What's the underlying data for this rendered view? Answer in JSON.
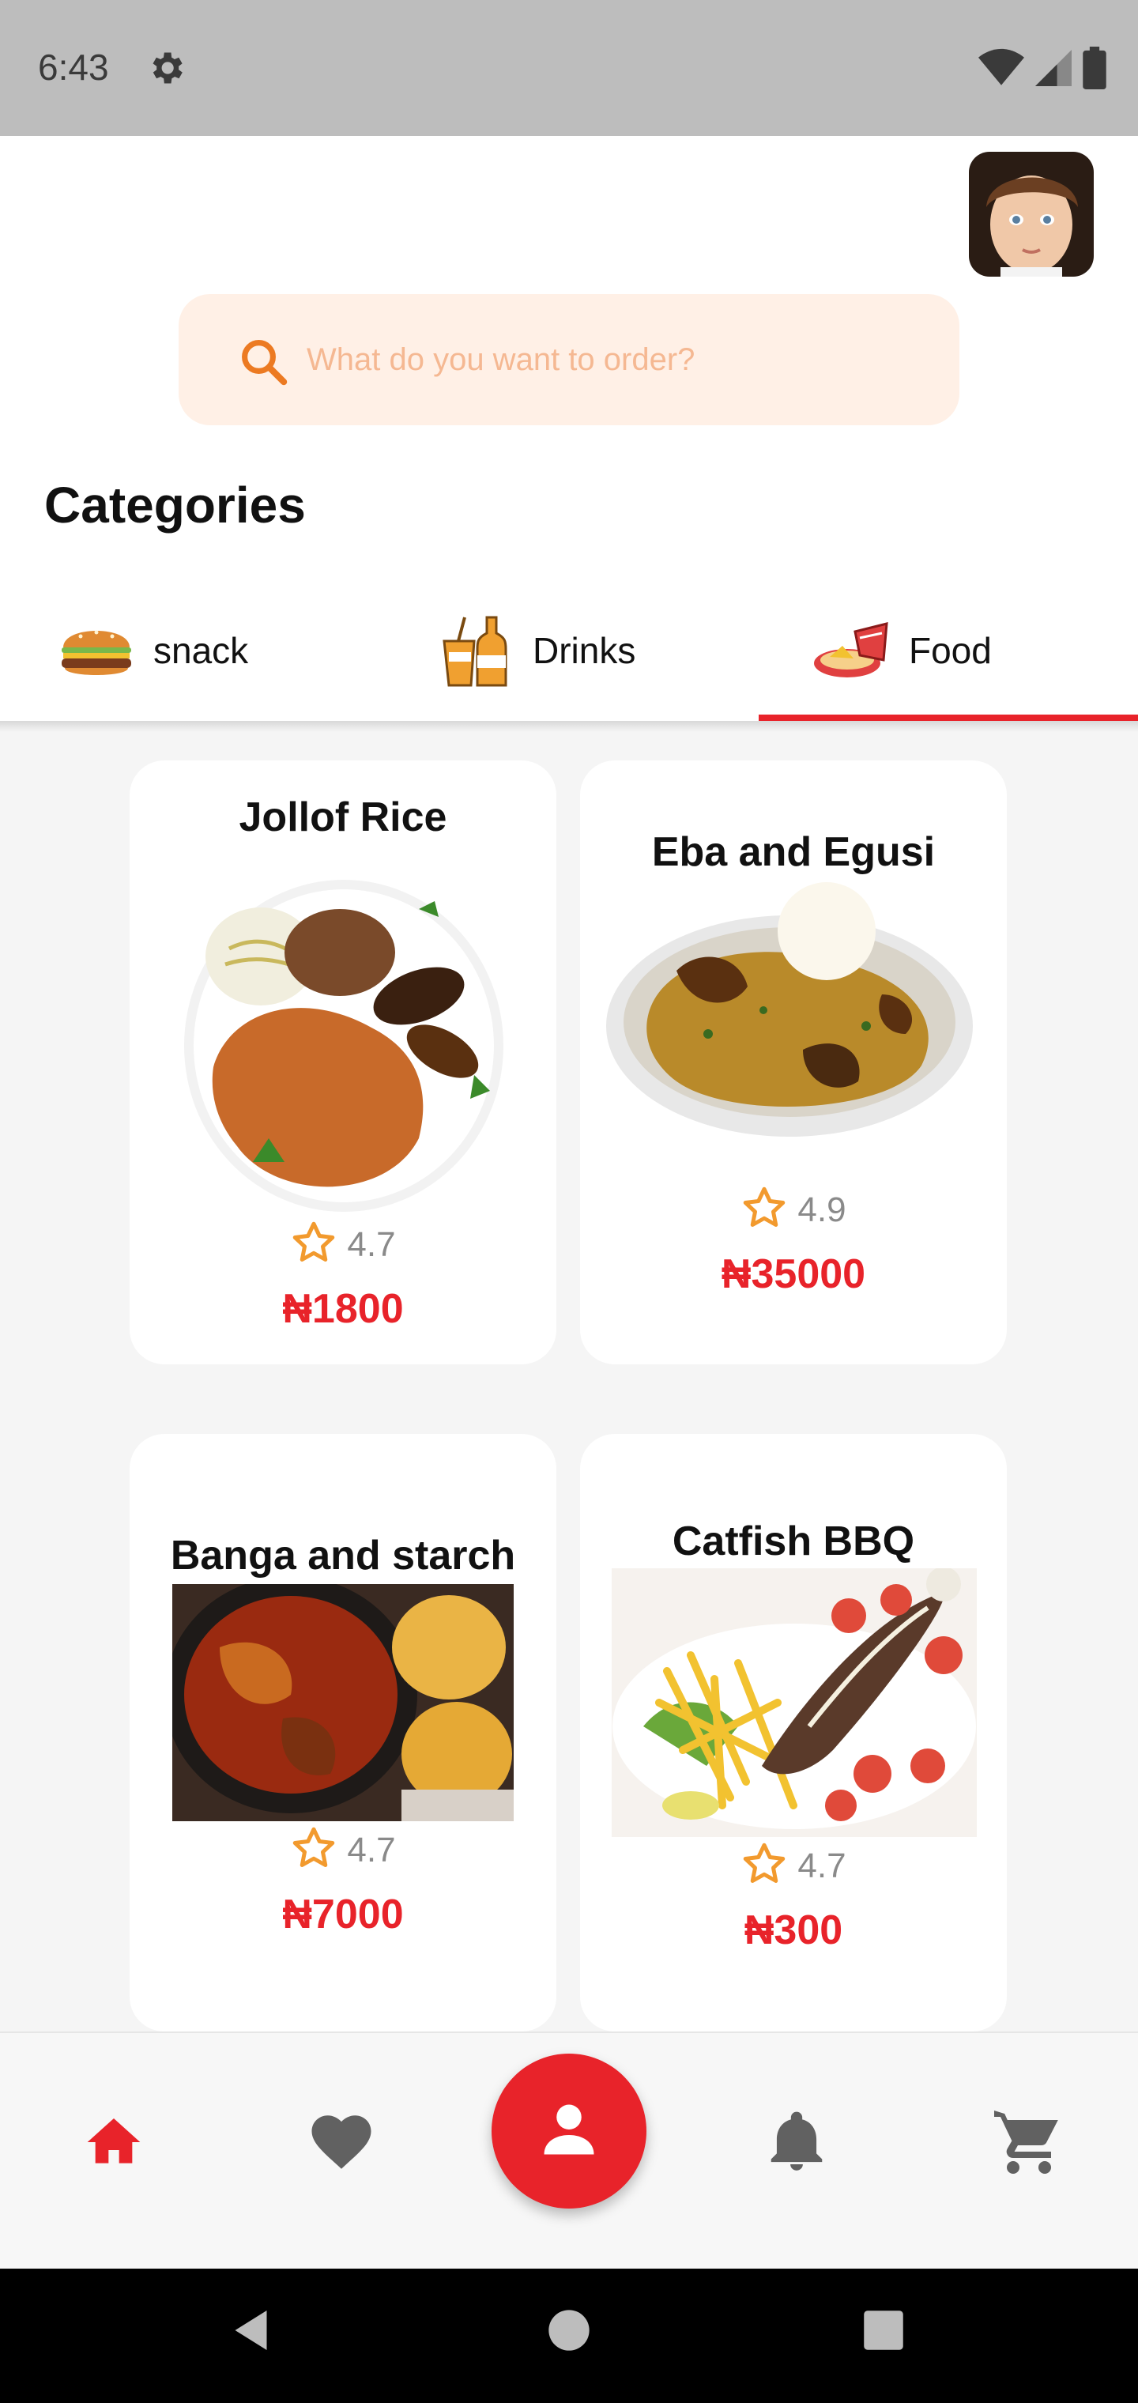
{
  "status_bar": {
    "time": "6:43",
    "icons": [
      "gear-icon",
      "wifi-icon",
      "signal-icon",
      "battery-icon"
    ]
  },
  "header": {
    "avatar": "profile-avatar",
    "search": {
      "placeholder": "What do you want to order?",
      "value": ""
    }
  },
  "categories": {
    "title": "Categories",
    "tabs": [
      {
        "label": "snack",
        "icon": "burger-icon",
        "selected": false
      },
      {
        "label": "Drinks",
        "icon": "drinks-icon",
        "selected": false
      },
      {
        "label": "Food",
        "icon": "food-icon",
        "selected": true
      }
    ]
  },
  "products": [
    {
      "name": "Jollof Rice",
      "rating": "4.7",
      "price": "₦1800"
    },
    {
      "name": "Eba and Egusi",
      "rating": "4.9",
      "price": "₦35000"
    },
    {
      "name": "Banga and starch",
      "rating": "4.7",
      "price": "₦7000"
    },
    {
      "name": "Catfish BBQ",
      "rating": "4.7",
      "price": "₦300"
    }
  ],
  "bottom_nav": {
    "items": [
      "home-icon",
      "heart-icon",
      "profile-icon",
      "bell-icon",
      "cart-icon"
    ],
    "active": "home-icon"
  },
  "colors": {
    "accent": "#e8232a",
    "search_bg": "#fff0e6",
    "placeholder": "#f5b892",
    "star": "#f29a2e"
  }
}
